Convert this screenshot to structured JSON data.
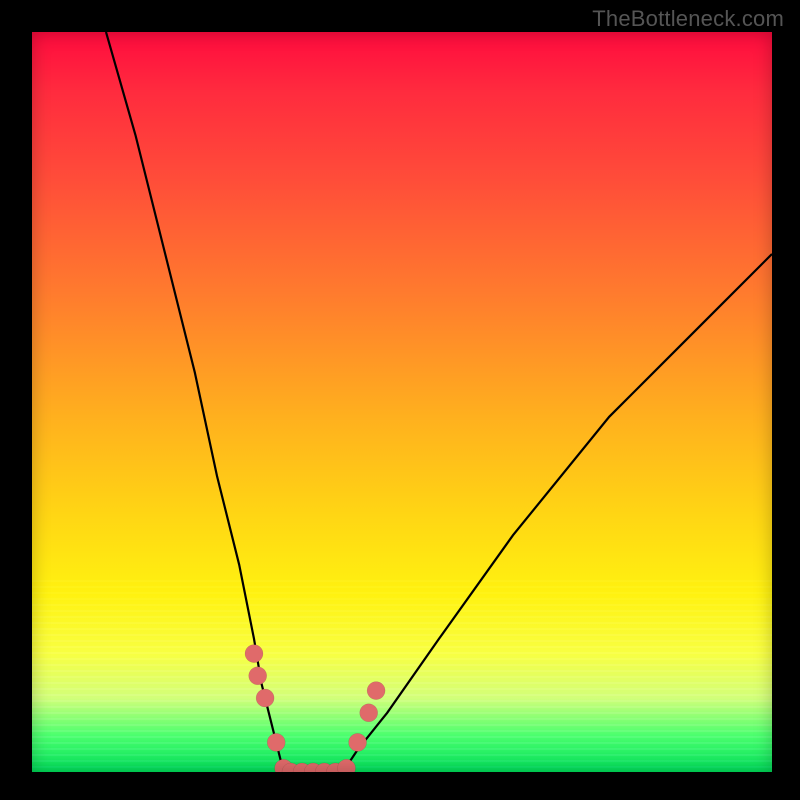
{
  "watermark": "TheBottleneck.com",
  "chart_data": {
    "type": "line",
    "title": "",
    "xlabel": "",
    "ylabel": "",
    "xlim": [
      0,
      100
    ],
    "ylim": [
      0,
      100
    ],
    "grid": false,
    "legend": false,
    "notes": "Two-branch V-shaped curve over a vertical red-to-green gradient. Marker dots cluster at the bottom of the V. No axes, ticks, or labels are shown.",
    "series": [
      {
        "name": "left-branch",
        "x": [
          10,
          14,
          18,
          22,
          25,
          28,
          30,
          31,
          32,
          33,
          34
        ],
        "y": [
          100,
          86,
          70,
          54,
          40,
          28,
          18,
          12,
          8,
          4,
          0
        ]
      },
      {
        "name": "valley-floor",
        "x": [
          34,
          36,
          38,
          40,
          42
        ],
        "y": [
          0,
          0,
          0,
          0,
          0
        ]
      },
      {
        "name": "right-branch",
        "x": [
          42,
          44,
          48,
          55,
          65,
          78,
          92,
          100
        ],
        "y": [
          0,
          3,
          8,
          18,
          32,
          48,
          62,
          70
        ]
      }
    ],
    "markers": [
      {
        "x": 30.0,
        "y": 16
      },
      {
        "x": 30.5,
        "y": 13
      },
      {
        "x": 31.5,
        "y": 10
      },
      {
        "x": 33.0,
        "y": 4
      },
      {
        "x": 34.0,
        "y": 0.5
      },
      {
        "x": 35.0,
        "y": 0
      },
      {
        "x": 36.5,
        "y": 0
      },
      {
        "x": 38.0,
        "y": 0
      },
      {
        "x": 39.5,
        "y": 0
      },
      {
        "x": 41.0,
        "y": 0
      },
      {
        "x": 42.5,
        "y": 0.5
      },
      {
        "x": 44.0,
        "y": 4
      },
      {
        "x": 45.5,
        "y": 8
      },
      {
        "x": 46.5,
        "y": 11
      }
    ],
    "marker_color": "#e06a6a",
    "gradient_stops": [
      {
        "pos": 0.0,
        "color": "#ff0b3e"
      },
      {
        "pos": 0.35,
        "color": "#ff7a2e"
      },
      {
        "pos": 0.65,
        "color": "#ffd514"
      },
      {
        "pos": 0.9,
        "color": "#d2ff7a"
      },
      {
        "pos": 1.0,
        "color": "#00e05a"
      }
    ]
  }
}
